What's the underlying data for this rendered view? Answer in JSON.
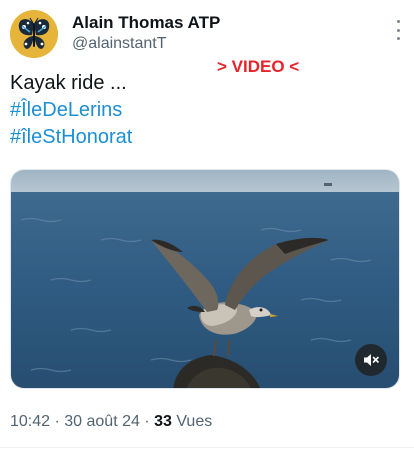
{
  "author": {
    "display_name": "Alain Thomas ATP",
    "handle": "@alainstantT",
    "avatar_icon": "butterfly-icon"
  },
  "more_icon": "more-vertical-icon",
  "video_tag": "> VIDEO <",
  "tweet": {
    "text": "Kayak ride ...",
    "hashtags": [
      "#ÎleDeLerins",
      "#îleStHonorat"
    ]
  },
  "media": {
    "type": "video",
    "mute_icon": "volume-muted-icon"
  },
  "meta": {
    "time": "10:42",
    "sep1": " · ",
    "date": "30 août 24",
    "sep2": " · ",
    "views_count": "33",
    "views_label": " Vues"
  },
  "colors": {
    "hashtag": "#1d8fd4",
    "video_tag": "#e8232a",
    "avatar_bg": "#e8b93a",
    "secondary_text": "#536471"
  }
}
